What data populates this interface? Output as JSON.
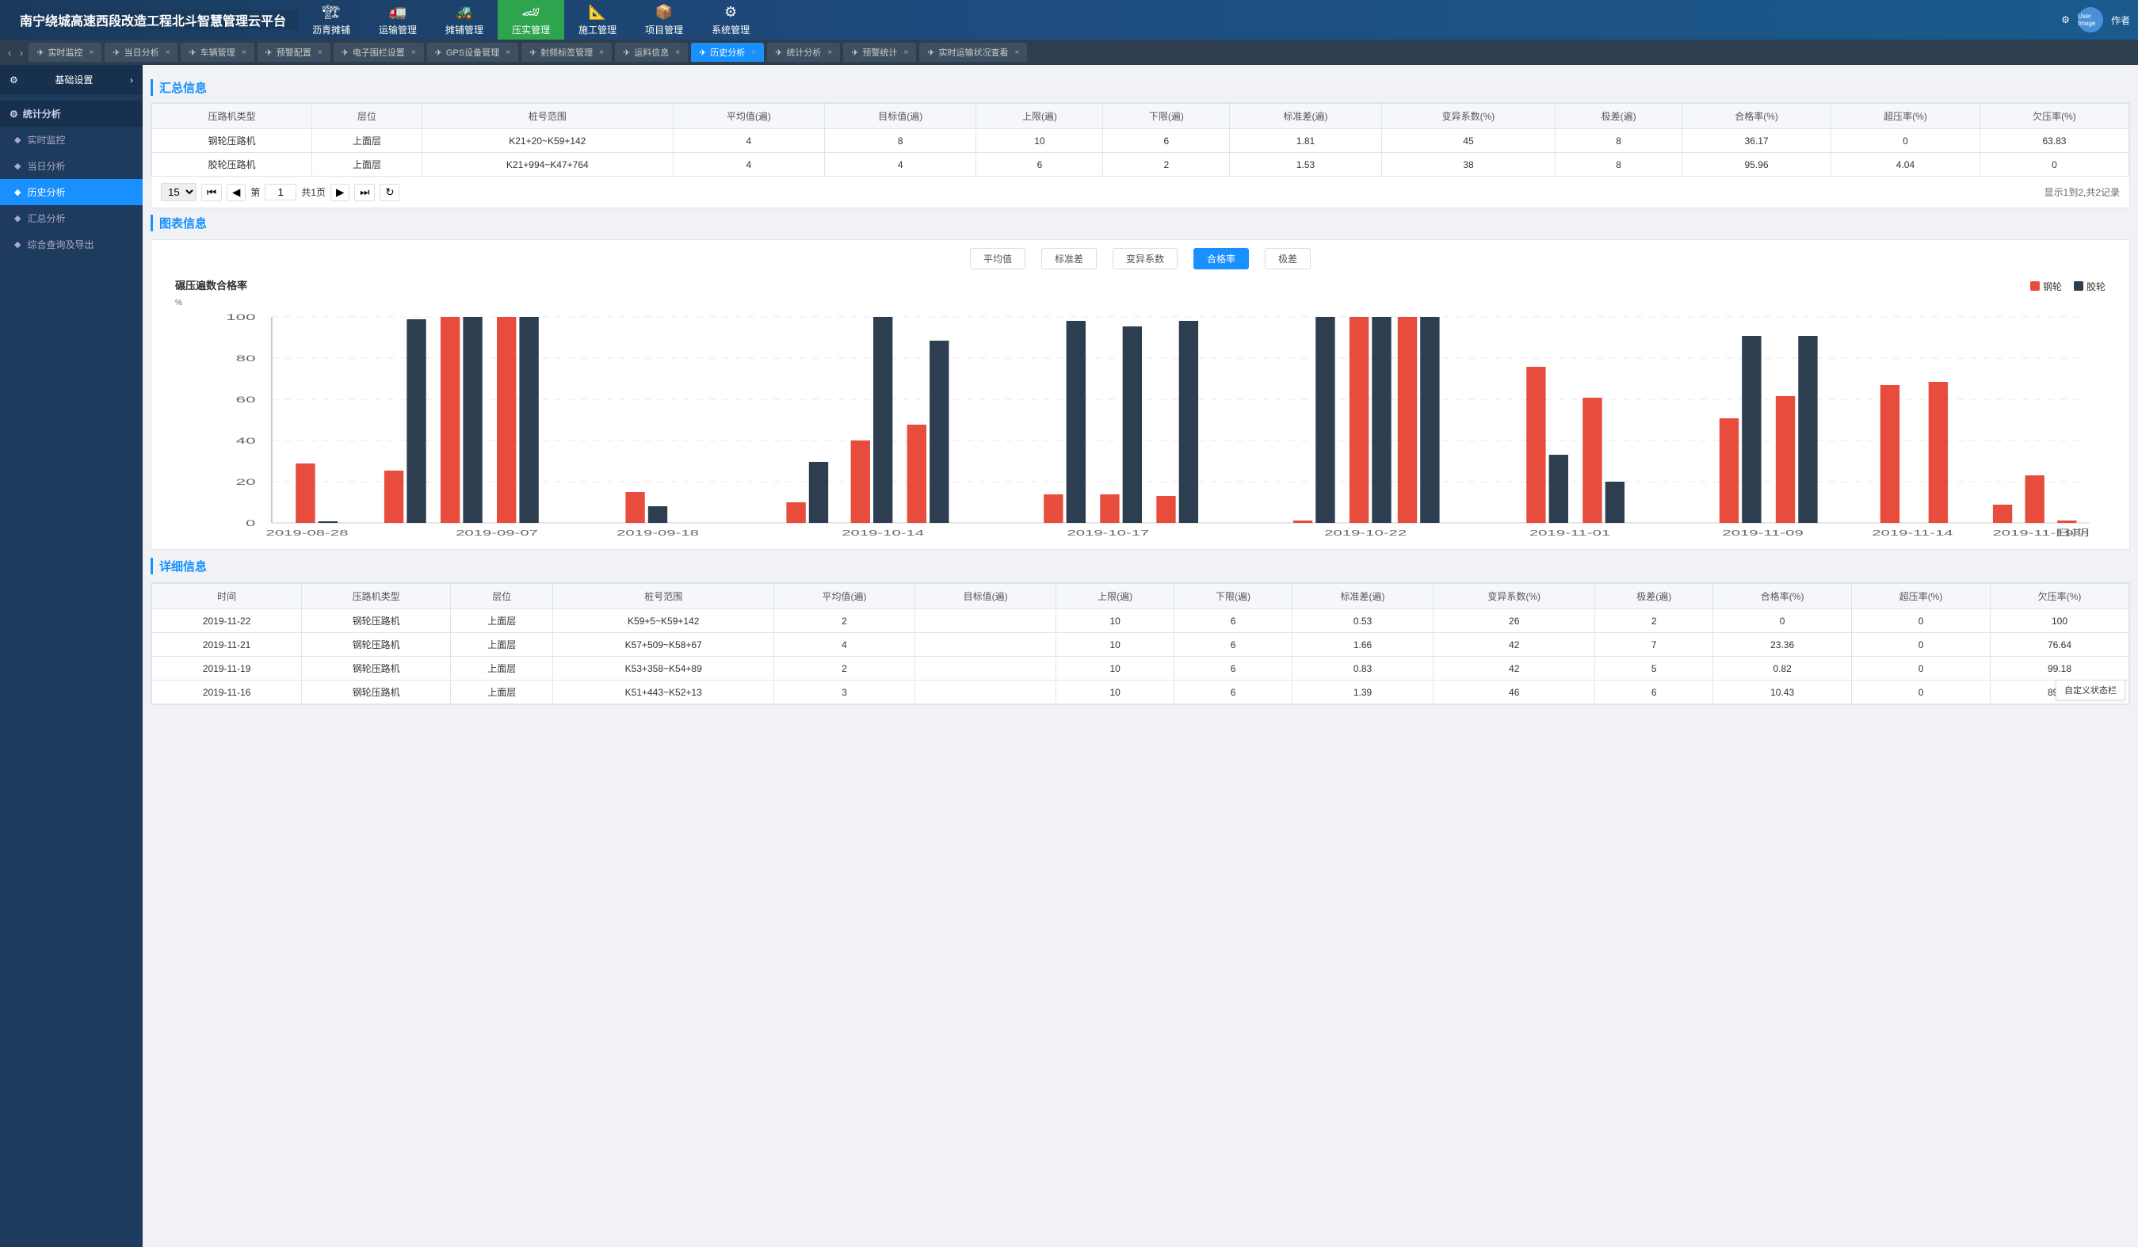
{
  "app": {
    "title": "南宁绕城高速西段改造工程北斗智慧管理云平台"
  },
  "topNav": {
    "items": [
      {
        "id": "asphalt",
        "icon": "🏗",
        "label": "沥青摊铺"
      },
      {
        "id": "transport",
        "icon": "🚛",
        "label": "运输管理"
      },
      {
        "id": "roller",
        "icon": "🚜",
        "label": "摊铺管理"
      },
      {
        "id": "compaction",
        "icon": "🏎",
        "label": "压实管理",
        "active": true
      },
      {
        "id": "construction",
        "icon": "📐",
        "label": "施工管理"
      },
      {
        "id": "project",
        "icon": "📦",
        "label": "项目管理"
      },
      {
        "id": "system",
        "icon": "⚙",
        "label": "系统管理"
      }
    ],
    "settingsLabel": "作者",
    "userLabel": "User Image"
  },
  "tabs": [
    {
      "id": "realtime",
      "icon": "📡",
      "label": "实时监控",
      "active": false
    },
    {
      "id": "today",
      "icon": "📅",
      "label": "当日分析",
      "active": false
    },
    {
      "id": "vehicle",
      "icon": "🚗",
      "label": "车辆管理",
      "active": false
    },
    {
      "id": "preconfig",
      "icon": "⚙",
      "label": "预警配置",
      "active": false
    },
    {
      "id": "efence",
      "icon": "📌",
      "label": "电子围栏设置",
      "active": false
    },
    {
      "id": "gps",
      "icon": "📡",
      "label": "GPS设备管理",
      "active": false
    },
    {
      "id": "rfid",
      "icon": "📶",
      "label": "射频标签管理",
      "active": false
    },
    {
      "id": "transport-info",
      "icon": "📋",
      "label": "运料信息",
      "active": false
    },
    {
      "id": "history",
      "icon": "📊",
      "label": "历史分析",
      "active": true
    },
    {
      "id": "stats",
      "icon": "📈",
      "label": "统计分析",
      "active": false
    },
    {
      "id": "warning-stats",
      "icon": "⚠",
      "label": "预警统计",
      "active": false
    },
    {
      "id": "realtime-transport",
      "icon": "🚚",
      "label": "实时运输状况查看",
      "active": false
    }
  ],
  "sidebar": {
    "settings": {
      "label": "基础设置",
      "icon": "⚙"
    },
    "sections": [
      {
        "id": "stats-analysis",
        "label": "统计分析",
        "items": [
          {
            "id": "realtime-monitor",
            "icon": "◆",
            "label": "实时监控"
          },
          {
            "id": "today-analysis",
            "icon": "◆",
            "label": "当日分析"
          },
          {
            "id": "history-analysis",
            "icon": "◆",
            "label": "历史分析",
            "active": true
          },
          {
            "id": "summary-analysis",
            "icon": "◆",
            "label": "汇总分析"
          },
          {
            "id": "comprehensive",
            "icon": "◆",
            "label": "综合查询及导出"
          }
        ]
      }
    ]
  },
  "summary": {
    "sectionTitle": "汇总信息",
    "tableHeaders": [
      "压路机类型",
      "层位",
      "桩号范围",
      "平均值(遍)",
      "目标值(遍)",
      "上限(遍)",
      "下限(遍)",
      "标准差(遍)",
      "变异系数(%)",
      "极差(遍)",
      "合格率(%)",
      "超压率(%)",
      "欠压率(%)"
    ],
    "tableRows": [
      [
        "钢轮压路机",
        "上面层",
        "K21+20~K59+142",
        "4",
        "8",
        "10",
        "6",
        "1.81",
        "45",
        "8",
        "36.17",
        "0",
        "63.83"
      ],
      [
        "胶轮压路机",
        "上面层",
        "K21+994~K47+764",
        "4",
        "4",
        "6",
        "2",
        "1.53",
        "38",
        "8",
        "95.96",
        "4.04",
        "0"
      ]
    ],
    "pagination": {
      "perPage": "15",
      "currentPage": "1",
      "totalPages": "共1页",
      "displayInfo": "显示1到2,共2记录"
    }
  },
  "chart": {
    "sectionTitle": "图表信息",
    "filterButtons": [
      "平均值",
      "标准差",
      "变异系数",
      "合格率",
      "极差"
    ],
    "activeFilter": "合格率",
    "chartTitle": "碾压遍数合格率",
    "legend": [
      {
        "label": "钢轮",
        "color": "#e74c3c"
      },
      {
        "label": "胶轮",
        "color": "#2c3e50"
      }
    ],
    "yAxisLabel": "%",
    "xAxisLabel": "日期",
    "yAxisValues": [
      "0",
      "20",
      "40",
      "60",
      "80",
      "100"
    ],
    "xAxisLabels": [
      "2019-08-28",
      "2019-09-07",
      "2019-09-18",
      "2019-10-14",
      "2019-10-17",
      "2019-10-22",
      "2019-11-01",
      "2019-11-09",
      "2019-11-14",
      "2019-11-19"
    ],
    "barGroups": [
      {
        "date": "2019-08-28",
        "red": 28,
        "dark": 3
      },
      {
        "date": "2019-09-07",
        "red": 25,
        "dark": 97
      },
      {
        "date": "2019-09-07b",
        "red": 97,
        "dark": 99
      },
      {
        "date": "2019-09-07c",
        "red": 99,
        "dark": 99
      },
      {
        "date": "2019-09-18",
        "red": 15,
        "dark": 8
      },
      {
        "date": "2019-10-14a",
        "red": 10,
        "dark": 29
      },
      {
        "date": "2019-10-14b",
        "red": 39,
        "dark": 100
      },
      {
        "date": "2019-10-14c",
        "red": 48,
        "dark": 88
      },
      {
        "date": "2019-10-17a",
        "red": 14,
        "dark": 97
      },
      {
        "date": "2019-10-17b",
        "red": 14,
        "dark": 95
      },
      {
        "date": "2019-10-17c",
        "red": 13,
        "dark": 97
      },
      {
        "date": "2019-10-22a",
        "red": 1,
        "dark": 99
      },
      {
        "date": "2019-10-22b",
        "red": 97,
        "dark": 100
      },
      {
        "date": "2019-10-22c",
        "red": 100,
        "dark": 99
      },
      {
        "date": "2019-11-01a",
        "red": 76,
        "dark": 33
      },
      {
        "date": "2019-11-01b",
        "red": 61,
        "dark": 20
      },
      {
        "date": "2019-11-09a",
        "red": 51,
        "dark": 91
      },
      {
        "date": "2019-11-09b",
        "red": 62,
        "dark": 91
      },
      {
        "date": "2019-11-14a",
        "red": 67,
        "dark": 0
      },
      {
        "date": "2019-11-14b",
        "red": 68,
        "dark": 0
      },
      {
        "date": "2019-11-19a",
        "red": 9,
        "dark": 0
      },
      {
        "date": "2019-11-19b",
        "red": 23,
        "dark": 0
      },
      {
        "date": "2019-11-19c",
        "red": 1,
        "dark": 0
      }
    ]
  },
  "detail": {
    "sectionTitle": "详细信息",
    "tableHeaders": [
      "时间",
      "压路机类型",
      "层位",
      "桩号范围",
      "平均值(遍)",
      "目标值(遍)",
      "上限(遍)",
      "下限(遍)",
      "标准差(遍)",
      "变异系数(%)",
      "极差(遍)",
      "合格率(%)",
      "超压率(%)",
      "欠压率(%)"
    ],
    "tableRows": [
      [
        "2019-11-22",
        "钢轮压路机",
        "上面层",
        "K59+5~K59+142",
        "2",
        "",
        "10",
        "6",
        "0.53",
        "26",
        "2",
        "0",
        "0",
        "100"
      ],
      [
        "2019-11-21",
        "钢轮压路机",
        "上面层",
        "K57+509~K58+67",
        "4",
        "",
        "10",
        "6",
        "1.66",
        "42",
        "7",
        "23.36",
        "0",
        "76.64"
      ],
      [
        "2019-11-19",
        "钢轮压路机",
        "上面层",
        "K53+358~K54+89",
        "2",
        "",
        "10",
        "6",
        "0.83",
        "42",
        "5",
        "0.82",
        "0",
        "99.18"
      ],
      [
        "2019-11-16",
        "钢轮压路机",
        "上面层",
        "K51+443~K52+13",
        "3",
        "",
        "10",
        "6",
        "1.39",
        "46",
        "6",
        "10.43",
        "0",
        "89.57"
      ]
    ],
    "customStatusBar": "自定义状态栏"
  }
}
